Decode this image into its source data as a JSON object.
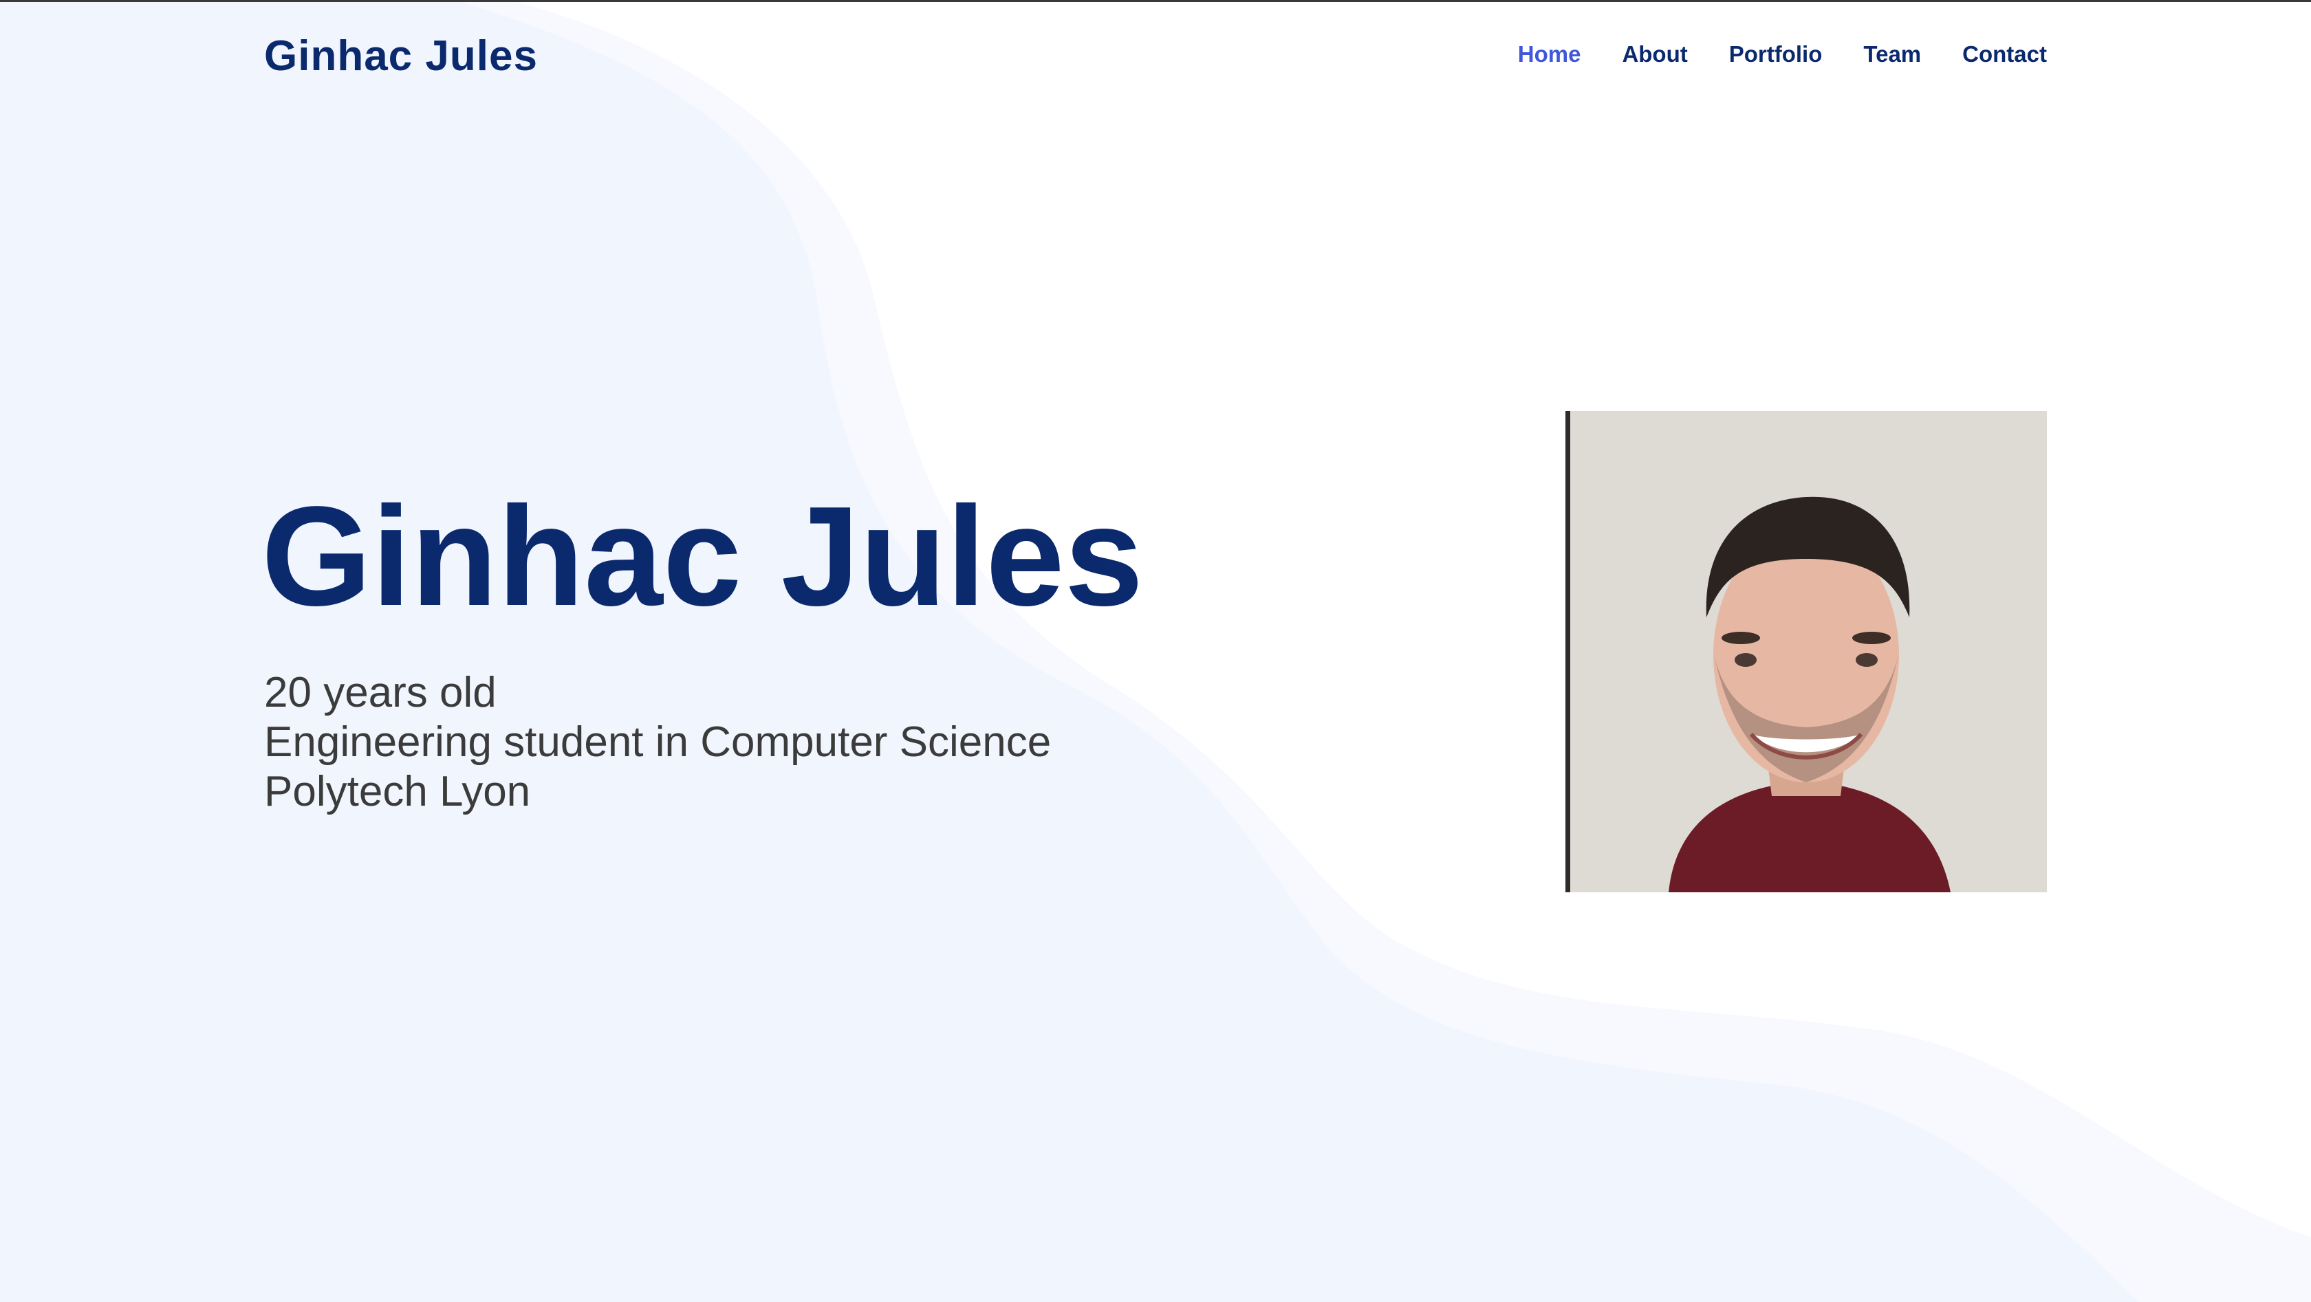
{
  "site": {
    "brand": "Ginhac Jules"
  },
  "nav": {
    "items": [
      {
        "label": "Home",
        "active": true
      },
      {
        "label": "About",
        "active": false
      },
      {
        "label": "Portfolio",
        "active": false
      },
      {
        "label": "Team",
        "active": false
      },
      {
        "label": "Contact",
        "active": false
      }
    ]
  },
  "hero": {
    "name": "Ginhac Jules",
    "lines": [
      "20 years old",
      "Engineering student in Computer Science",
      "Polytech Lyon"
    ],
    "photo_alt": "Portrait photo"
  },
  "colors": {
    "primary": "#0b2a6e",
    "accent": "#4057d9",
    "body_text": "#3b3b3b",
    "wave_light": "#f1f5fd",
    "wave_lighter": "#f7f9fe",
    "background": "#ffffff"
  }
}
